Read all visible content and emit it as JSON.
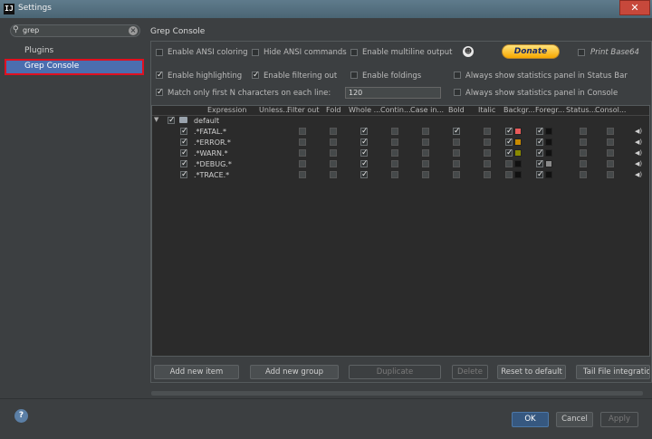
{
  "window": {
    "title": "Settings",
    "app_icon": "IJ"
  },
  "sidebar": {
    "search_value": "grep",
    "items": [
      {
        "label": "Plugins"
      },
      {
        "label": "Grep Console",
        "selected": true
      }
    ]
  },
  "content": {
    "title": "Grep Console",
    "options": {
      "ansi": "Enable ANSI coloring",
      "hide_ansi": "Hide ANSI commands",
      "multiline": "Enable multiline output",
      "donate": "Donate",
      "print_base64": "Print Base64",
      "highlighting": "Enable highlighting",
      "filtering": "Enable filtering out",
      "foldings": "Enable foldings",
      "stats_status": "Always show statistics panel in Status Bar",
      "match_first": "Match only first N characters on each line:",
      "match_value": "120",
      "stats_console": "Always show statistics panel in Console"
    },
    "columns": [
      "Expression",
      "Unless...",
      "Filter out",
      "Fold",
      "Whole ...",
      "Contin...",
      "Case in...",
      "Bold",
      "Italic",
      "Backgr...",
      "Foregr...",
      "Status...",
      "Consol..."
    ],
    "group": "default",
    "rows": [
      {
        "expr": ".*FATAL.*",
        "bg": "#e85a5a",
        "fg": "#111111"
      },
      {
        "expr": ".*ERROR.*",
        "bg": "#c88a00",
        "fg": "#111111"
      },
      {
        "expr": ".*WARN.*",
        "bg": "#8a8a00",
        "fg": "#111111"
      },
      {
        "expr": ".*DEBUG.*",
        "bg": "#111111",
        "fg": "#8a8a8a"
      },
      {
        "expr": ".*TRACE.*",
        "bg": "#111111",
        "fg": "#111111"
      }
    ],
    "buttons": {
      "add_item": "Add new item",
      "add_group": "Add new group",
      "duplicate": "Duplicate",
      "delete": "Delete",
      "reset": "Reset to default",
      "tail": "Tail File integration"
    }
  },
  "footer": {
    "ok": "OK",
    "cancel": "Cancel",
    "apply": "Apply"
  },
  "colors": {
    "selection": "#4b6eaf",
    "highlight_border": "#e01020",
    "accent": "#365880"
  }
}
